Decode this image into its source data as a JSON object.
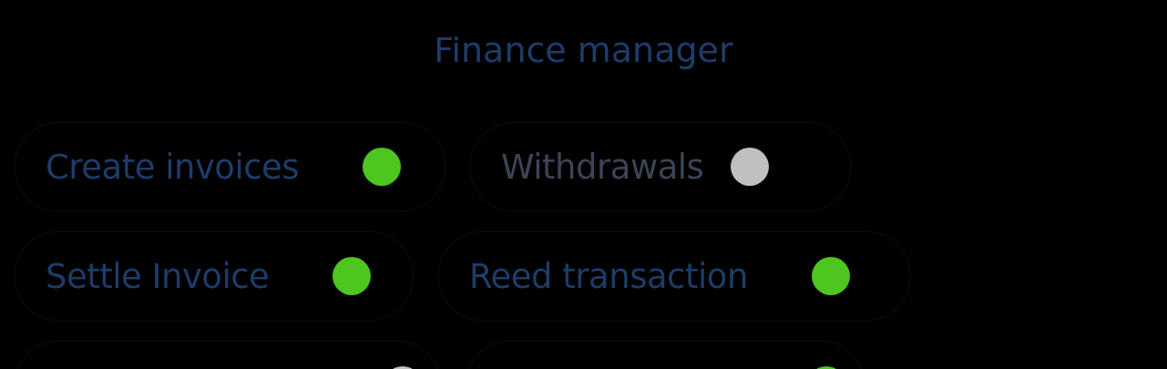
{
  "title": "Finance manager",
  "rows": [
    {
      "items": [
        {
          "label": "Create invoices",
          "on": true
        },
        {
          "label": "Withdrawals",
          "on": false
        }
      ]
    },
    {
      "items": [
        {
          "label": "Settle Invoice",
          "on": true
        },
        {
          "label": "Reed transaction",
          "on": true
        }
      ]
    },
    {
      "items": [
        {
          "on": false
        },
        {
          "on": true
        }
      ]
    }
  ]
}
